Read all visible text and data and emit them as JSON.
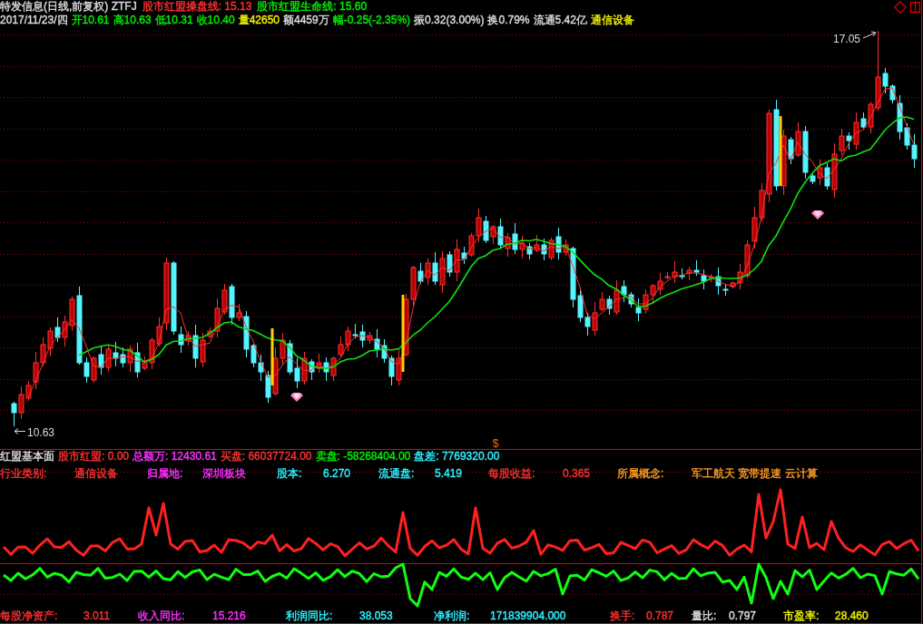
{
  "header": {
    "title": {
      "text": "特发信息(日线,前复权) ZTFJ",
      "color": "#dcdcdc"
    },
    "indicators": [
      {
        "text": "股市红盟操盘线: 15.13",
        "color": "#ff3030"
      },
      {
        "text": "股市红盟生命线: 15.60",
        "color": "#00f000"
      }
    ],
    "quote": [
      {
        "text": "2017/11/23/四",
        "color": "#dcdcdc"
      },
      {
        "text": "开10.61",
        "color": "#00f000"
      },
      {
        "text": "高10.63",
        "color": "#00f000"
      },
      {
        "text": "低10.31",
        "color": "#00f000"
      },
      {
        "text": "收10.40",
        "color": "#00f000"
      },
      {
        "text": "量42650",
        "color": "#f0f000"
      },
      {
        "text": "额4459万",
        "color": "#dcdcdc"
      },
      {
        "text": "幅-0.25(-2.35%)",
        "color": "#00f000"
      },
      {
        "text": "振0.32(3.00%)",
        "color": "#dcdcdc"
      },
      {
        "text": "换0.79%",
        "color": "#dcdcdc"
      },
      {
        "text": "流通5.42亿",
        "color": "#dcdcdc"
      },
      {
        "text": "通信设备",
        "color": "#f0f000"
      }
    ]
  },
  "price_chart": {
    "high_label": "17.05",
    "low_label": "10.63",
    "marker": "$"
  },
  "fundamentals": {
    "title": "红盟基本面",
    "summary": [
      {
        "text": "股市红盟: 0.00",
        "color": "#ff3030"
      },
      {
        "text": "总额万: 12430.61",
        "color": "#ff30ff"
      },
      {
        "text": "买盘: 66037724.00",
        "color": "#ff3030"
      },
      {
        "text": "卖盘: -58268404.00",
        "color": "#00f000"
      },
      {
        "text": "盘差: 7769320.00",
        "color": "#30f0ff"
      }
    ],
    "details": [
      {
        "label": "行业类别:",
        "value": "通信设备",
        "color": "#ff3030"
      },
      {
        "label": "归属地:",
        "value": "深圳板块",
        "color": "#ff30ff"
      },
      {
        "label": "股本:",
        "value": "6.270",
        "color": "#30f0ff"
      },
      {
        "label": "流通盘:",
        "value": "5.419",
        "color": "#30f0ff"
      },
      {
        "label": "每股收益:",
        "value": "0.365",
        "color": "#ff3030"
      },
      {
        "label": "所属概念:",
        "value": "军工航天 宽带提速 云计算",
        "color": "#ff9a20"
      }
    ],
    "stats": [
      {
        "label": "每股净资产:",
        "value": "3.011",
        "color": "#ff3030"
      },
      {
        "label": "收入同比:",
        "value": "15.216",
        "color": "#ff30ff"
      },
      {
        "label": "利润同比:",
        "value": "38.053",
        "color": "#30f0ff"
      },
      {
        "label": "净利润:",
        "value": "171839904.000",
        "color": "#30f0ff"
      },
      {
        "label": "换手:",
        "value": "0.787",
        "color": "#ff3030"
      },
      {
        "label": "量比:",
        "value": "0.797",
        "color": "#dcdcdc"
      },
      {
        "label": "市盈率:",
        "value": "28.460",
        "color": "#f0f000"
      }
    ]
  }
}
